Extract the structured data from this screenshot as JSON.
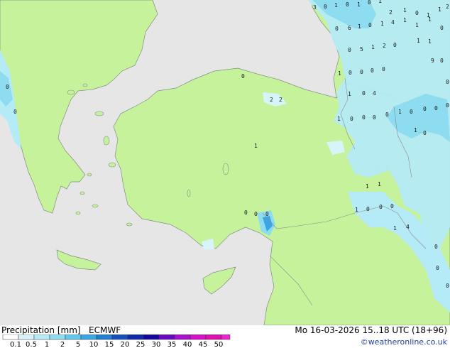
{
  "legend": {
    "title": "Precipitation [mm]",
    "model": "ECMWF",
    "ticks": [
      "0.1",
      "0.5",
      "1",
      "2",
      "5",
      "10",
      "15",
      "20",
      "25",
      "30",
      "35",
      "40",
      "45",
      "50"
    ],
    "colors": [
      "#ffffff",
      "#d8f4fb",
      "#b5ebf6",
      "#8edcf0",
      "#64c8ec",
      "#3aa6e4",
      "#1f7fd4",
      "#1550bd",
      "#0e2aa8",
      "#1606a0",
      "#6a09c0",
      "#a910cc",
      "#d410c8",
      "#e010b0",
      "#e826d0"
    ]
  },
  "valid_time": "Mo 16-03-2026 15..18 UTC (18+96)",
  "credit": "©weatheronline.co.uk",
  "map_values": [
    "3",
    "0",
    "1",
    "0",
    "1",
    "0",
    "1",
    "2",
    "1",
    "0",
    "1",
    "1",
    "2",
    "0",
    "6",
    "1",
    "0",
    "1",
    "4",
    "1",
    "1",
    "1",
    "0",
    "0",
    "5",
    "1",
    "2",
    "0",
    "1",
    "1",
    "0",
    "9",
    "1",
    "0",
    "0",
    "0",
    "0",
    "0",
    "1",
    "0",
    "4",
    "2",
    "2",
    "1",
    "0",
    "0",
    "0",
    "0",
    "1",
    "0",
    "0",
    "0",
    "0",
    "1",
    "0",
    "0",
    "1",
    "1",
    "1",
    "1",
    "0",
    "0",
    "0",
    "0",
    "0",
    "0",
    "1",
    "4",
    "0",
    "0",
    "0",
    "0",
    "0"
  ]
}
